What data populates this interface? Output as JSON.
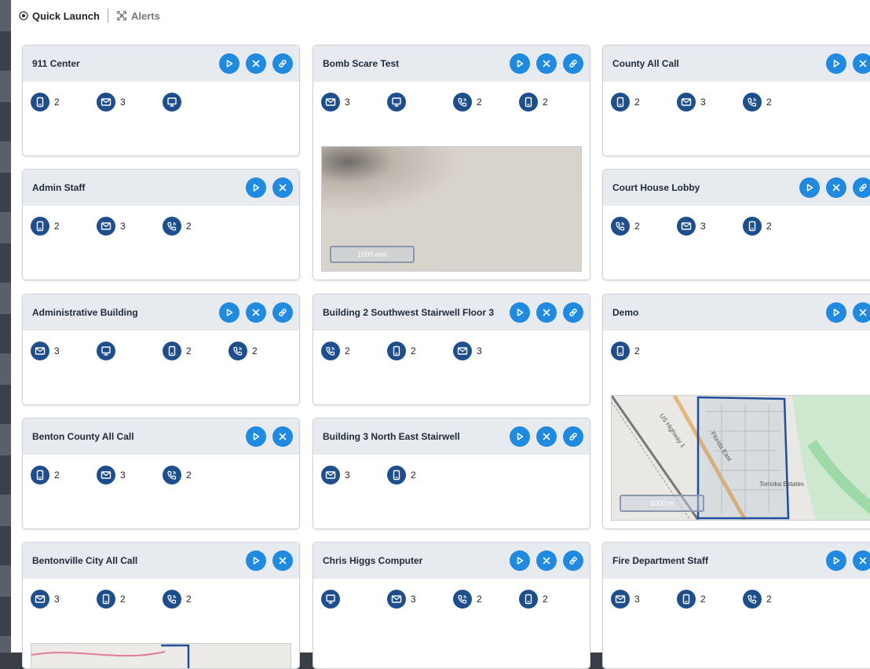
{
  "tabs": [
    {
      "label": "Quick Launch",
      "icon": "target-icon"
    },
    {
      "label": "Alerts",
      "icon": "crosshair-icon"
    }
  ],
  "colors": {
    "button": "#1f8ae0",
    "chip_icon": "#1e4f8c",
    "header": "#e7eaee"
  },
  "cards": [
    {
      "title": "911 Center",
      "actions": [
        "play",
        "cancel",
        "link"
      ],
      "chips": [
        {
          "icon": "tablet-icon",
          "count": "2"
        },
        {
          "icon": "mail-icon",
          "count": "3"
        },
        {
          "icon": "computer-icon",
          "count": ""
        }
      ]
    },
    {
      "title": "Admin Staff",
      "actions": [
        "play",
        "cancel"
      ],
      "chips": [
        {
          "icon": "tablet-icon",
          "count": "2"
        },
        {
          "icon": "mail-icon",
          "count": "3"
        },
        {
          "icon": "phone-icon",
          "count": "2"
        }
      ]
    },
    {
      "title": "Administrative Building",
      "actions": [
        "play",
        "cancel",
        "link"
      ],
      "chips": [
        {
          "icon": "mail-icon",
          "count": "3"
        },
        {
          "icon": "computer-icon",
          "count": ""
        },
        {
          "icon": "tablet-icon",
          "count": "2"
        },
        {
          "icon": "phone-icon",
          "count": "2"
        }
      ]
    },
    {
      "title": "Benton County All Call",
      "actions": [
        "play",
        "cancel"
      ],
      "chips": [
        {
          "icon": "tablet-icon",
          "count": "2"
        },
        {
          "icon": "mail-icon",
          "count": "3"
        },
        {
          "icon": "phone-icon",
          "count": "2"
        }
      ]
    },
    {
      "title": "Bentonville City All Call",
      "actions": [
        "play",
        "cancel"
      ],
      "chips": [
        {
          "icon": "mail-icon",
          "count": "3"
        },
        {
          "icon": "tablet-icon",
          "count": "2"
        },
        {
          "icon": "phone-icon",
          "count": "2"
        }
      ]
    },
    {
      "title": "Bomb Scare Test",
      "actions": [
        "play",
        "cancel",
        "link"
      ],
      "chips": [
        {
          "icon": "mail-icon",
          "count": "3"
        },
        {
          "icon": "computer-icon",
          "count": ""
        },
        {
          "icon": "phone-icon",
          "count": "2"
        },
        {
          "icon": "tablet-icon",
          "count": "2"
        }
      ],
      "map_scale": "1000 mm"
    },
    {
      "title": "Building 2 Southwest Stairwell Floor 3",
      "actions": [
        "play",
        "cancel",
        "link"
      ],
      "chips": [
        {
          "icon": "phone-icon",
          "count": "2"
        },
        {
          "icon": "tablet-icon",
          "count": "2"
        },
        {
          "icon": "mail-icon",
          "count": "3"
        }
      ]
    },
    {
      "title": "Building 3 North East Stairwell",
      "actions": [
        "play",
        "cancel",
        "link"
      ],
      "chips": [
        {
          "icon": "mail-icon",
          "count": "3"
        },
        {
          "icon": "tablet-icon",
          "count": "2"
        }
      ]
    },
    {
      "title": "Chris Higgs Computer",
      "actions": [
        "play",
        "cancel",
        "link"
      ],
      "chips": [
        {
          "icon": "computer-icon",
          "count": ""
        },
        {
          "icon": "mail-icon",
          "count": "3"
        },
        {
          "icon": "phone-icon",
          "count": "2"
        },
        {
          "icon": "tablet-icon",
          "count": "2"
        }
      ]
    },
    {
      "title": "County All Call",
      "actions": [
        "play",
        "cancel"
      ],
      "chips": [
        {
          "icon": "tablet-icon",
          "count": "2"
        },
        {
          "icon": "mail-icon",
          "count": "3"
        },
        {
          "icon": "phone-icon",
          "count": "2"
        }
      ]
    },
    {
      "title": "Court House Lobby",
      "actions": [
        "play",
        "cancel",
        "link"
      ],
      "chips": [
        {
          "icon": "phone-icon",
          "count": "2"
        },
        {
          "icon": "mail-icon",
          "count": "3"
        },
        {
          "icon": "tablet-icon",
          "count": "2"
        }
      ]
    },
    {
      "title": "Demo",
      "actions": [
        "play",
        "cancel"
      ],
      "chips": [
        {
          "icon": "tablet-icon",
          "count": "2"
        }
      ],
      "map_scale": "1000 m",
      "map_labels": [
        "US Highway 1",
        "Tomoka Estates",
        "Florida East"
      ]
    },
    {
      "title": "Fire Department Staff",
      "actions": [
        "play",
        "cancel"
      ],
      "chips": [
        {
          "icon": "mail-icon",
          "count": "3"
        },
        {
          "icon": "tablet-icon",
          "count": "2"
        },
        {
          "icon": "phone-icon",
          "count": "2"
        }
      ]
    }
  ]
}
